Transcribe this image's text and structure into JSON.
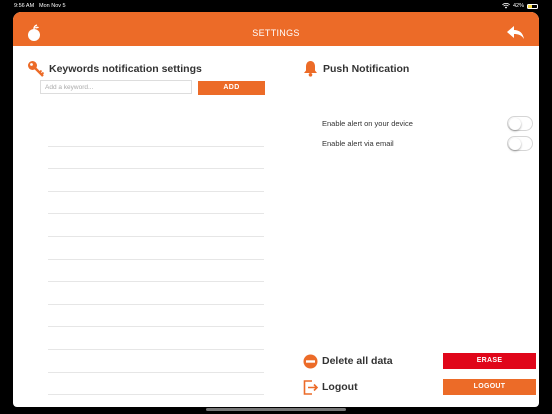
{
  "status_bar": {
    "time": "9:56 AM",
    "date": "Mon Nov 5",
    "battery": "42%",
    "battery_level": 0.42
  },
  "nav": {
    "title": "SETTINGS",
    "logo_icon": "apple-logo-icon",
    "back_icon": "reply-arrow-icon"
  },
  "keywords": {
    "title": "Keywords notification settings",
    "input_placeholder": "Add a keyword...",
    "input_value": "",
    "add_label": "ADD",
    "icon": "key-icon"
  },
  "push": {
    "title": "Push Notification",
    "icon": "bell-icon",
    "toggles": [
      {
        "label": "Enable alert on your device",
        "on": false
      },
      {
        "label": "Enable alert via email",
        "on": false
      }
    ]
  },
  "actions": {
    "delete_label": "Delete all data",
    "erase_label": "ERASE",
    "logout_label": "Logout",
    "logout_button": "LOGOUT"
  },
  "colors": {
    "accent": "#ec6b28",
    "danger": "#e0061a"
  }
}
